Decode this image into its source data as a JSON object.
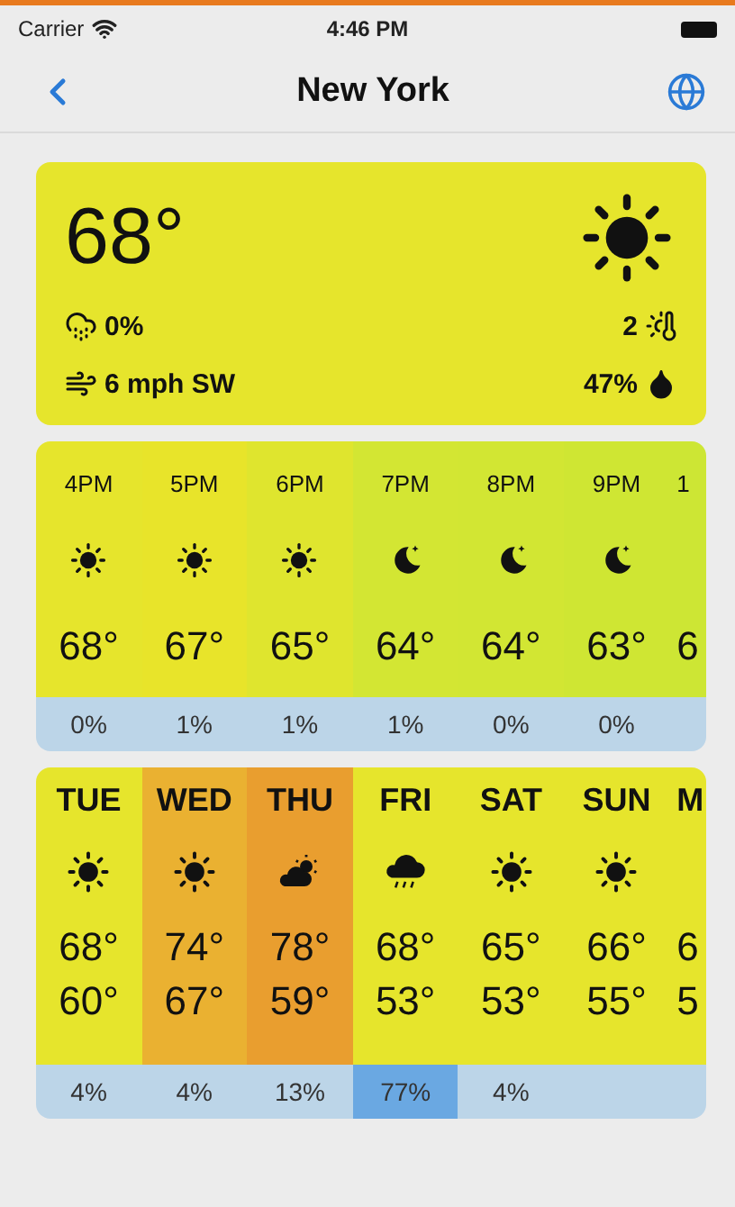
{
  "status_bar": {
    "carrier": "Carrier",
    "time": "4:46 PM"
  },
  "nav": {
    "title": "New York"
  },
  "current": {
    "temp": "68°",
    "kind": "sun",
    "precip": "0%",
    "uv": "2",
    "wind": "6 mph SW",
    "humidity": "47%"
  },
  "hourly": [
    {
      "time": "4PM",
      "kind": "sun",
      "temp": "68°",
      "precip": "0%",
      "color": "#e6e52c"
    },
    {
      "time": "5PM",
      "kind": "sun",
      "temp": "67°",
      "precip": "1%",
      "color": "#e8e42a"
    },
    {
      "time": "6PM",
      "kind": "sun",
      "temp": "65°",
      "precip": "1%",
      "color": "#dfe52e"
    },
    {
      "time": "7PM",
      "kind": "moon",
      "temp": "64°",
      "precip": "1%",
      "color": "#d3e633"
    },
    {
      "time": "8PM",
      "kind": "moon",
      "temp": "64°",
      "precip": "0%",
      "color": "#d2e633"
    },
    {
      "time": "9PM",
      "kind": "moon",
      "temp": "63°",
      "precip": "0%",
      "color": "#cfe633"
    },
    {
      "time": "1",
      "temp": "6",
      "color": "#cde634"
    }
  ],
  "daily": [
    {
      "day": "TUE",
      "kind": "sun",
      "high": "68°",
      "low": "60°",
      "color": "#e6e52c",
      "precip": {
        "value": "4%",
        "color": "#bcd5e8"
      }
    },
    {
      "day": "WED",
      "kind": "sun",
      "high": "74°",
      "low": "67°",
      "color": "#eab131",
      "precip": {
        "value": "4%",
        "color": "#bcd5e8"
      }
    },
    {
      "day": "THU",
      "kind": "cloud_sun",
      "high": "78°",
      "low": "59°",
      "color": "#e99e2f",
      "precip": {
        "value": "13%",
        "color": "#bcd5e8"
      }
    },
    {
      "day": "FRI",
      "kind": "rain",
      "high": "68°",
      "low": "53°",
      "color": "#e6e52c",
      "precip": {
        "value": "77%",
        "color": "#6aa8e2"
      }
    },
    {
      "day": "SAT",
      "kind": "sun",
      "high": "65°",
      "low": "53°",
      "color": "#e6e52c",
      "precip": {
        "value": "4%",
        "color": "#bcd5e8"
      }
    },
    {
      "day": "SUN",
      "kind": "sun",
      "high": "66°",
      "low": "55°",
      "color": "#e6e52c"
    },
    {
      "day": "M",
      "high": "6",
      "low": "5",
      "color": "#e6e52c"
    }
  ]
}
